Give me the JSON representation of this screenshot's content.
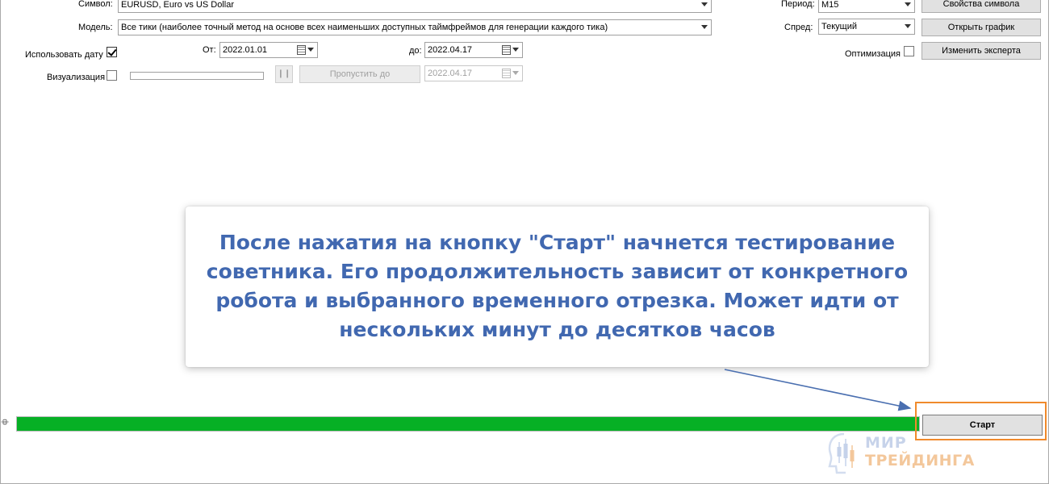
{
  "settings": {
    "symbol_label": "Символ:",
    "symbol_value": "EURUSD, Euro vs US Dollar",
    "model_label": "Модель:",
    "model_value": "Все тики (наиболее точный метод на основе всех наименьших доступных таймфреймов для генерации каждого тика)",
    "use_date_label": "Использовать дату",
    "use_date_checked": true,
    "from_label": "От:",
    "from_value": "2022.01.01",
    "to_label": "до:",
    "to_value": "2022.04.17",
    "visualization_label": "Визуализация",
    "skip_to_label": "Пропустить до",
    "skip_to_date": "2022.04.17",
    "period_label": "Период:",
    "period_value": "M15",
    "spread_label": "Спред:",
    "spread_value": "Текущий",
    "optimization_label": "Оптимизация",
    "symbol_properties_button": "Свойства символа",
    "open_chart_button": "Открыть график",
    "change_expert_button": "Изменить эксперта"
  },
  "callout": {
    "text": "После нажатия на кнопку \"Старт\" начнется тестирование советника. Его продолжительность зависит от конкретного робота и выбранного временного отрезка. Может идти от нескольких минут до десятков часов"
  },
  "progress": {
    "fraction": 1.0,
    "color": "#06b025"
  },
  "start_button": "Старт",
  "side_mark": "ф",
  "logo": {
    "line1": "МИР",
    "line2": "ТРЕЙДИНГА"
  },
  "colors": {
    "callout_text": "#4168b0",
    "highlight": "#f08a2c",
    "arrow": "#4a6fb0"
  },
  "icons": [
    "calendar-icon",
    "dropdown-arrow-icon",
    "pause-icon",
    "checkmark-icon",
    "candlestick-logo-icon"
  ]
}
